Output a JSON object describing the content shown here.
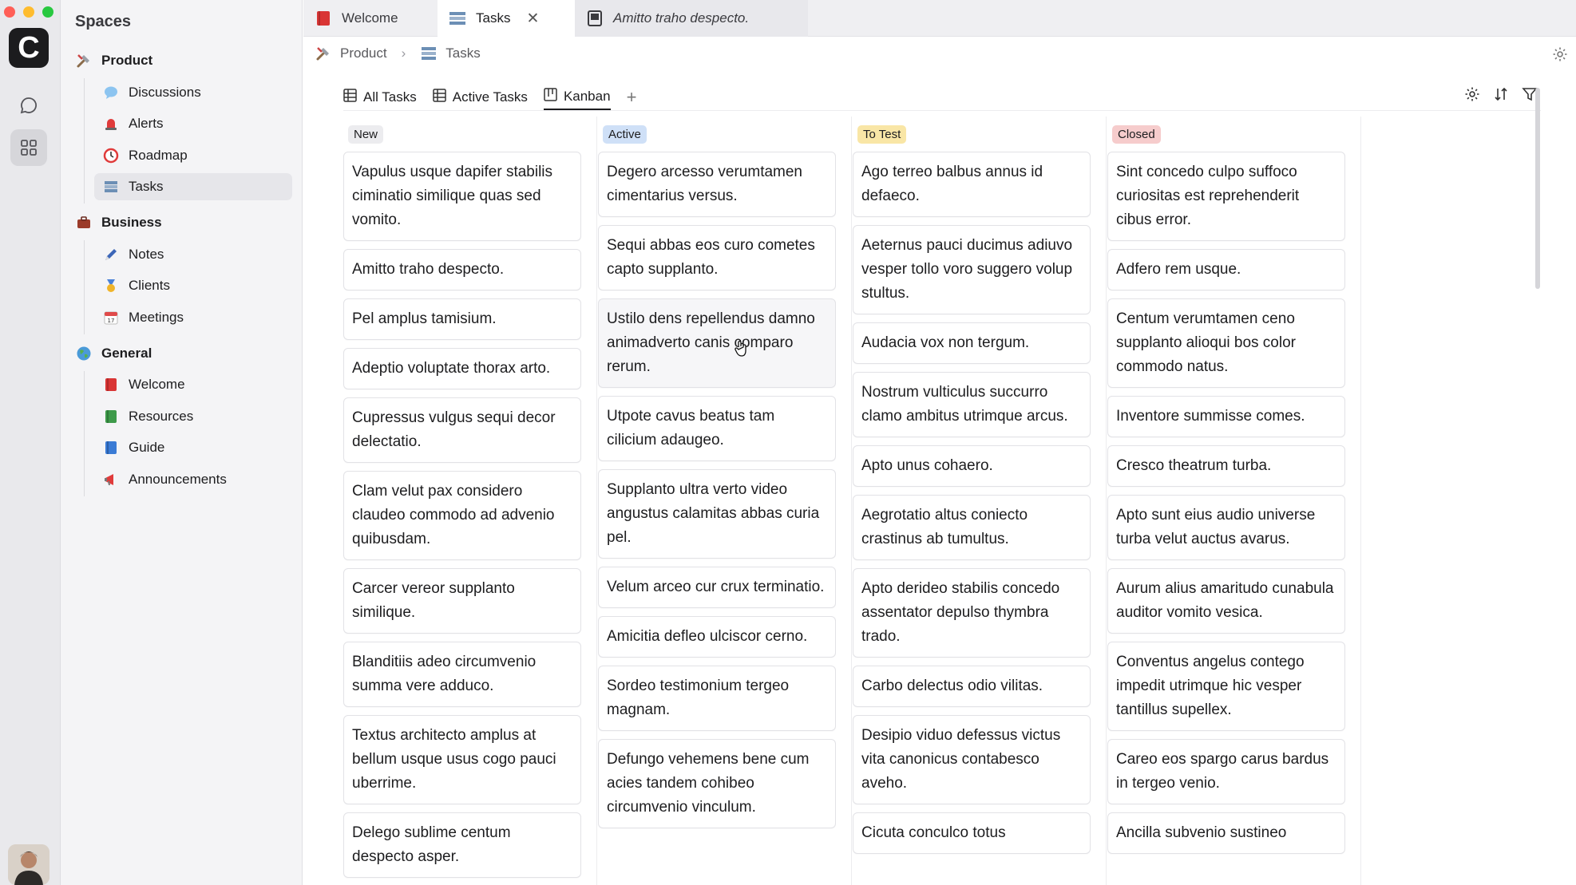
{
  "sidebar": {
    "title": "Spaces",
    "groups": [
      {
        "label": "Product",
        "items": [
          "Discussions",
          "Alerts",
          "Roadmap",
          "Tasks"
        ]
      },
      {
        "label": "Business",
        "items": [
          "Notes",
          "Clients",
          "Meetings"
        ]
      },
      {
        "label": "General",
        "items": [
          "Welcome",
          "Resources",
          "Guide",
          "Announcements"
        ]
      }
    ],
    "selected": "Tasks"
  },
  "tabs": [
    {
      "label": "Welcome"
    },
    {
      "label": "Tasks"
    },
    {
      "label": "Amitto traho despecto."
    }
  ],
  "breadcrumb": {
    "root": "Product",
    "current": "Tasks"
  },
  "views": [
    {
      "label": "All Tasks"
    },
    {
      "label": "Active Tasks"
    },
    {
      "label": "Kanban"
    }
  ],
  "add_view_label": "+",
  "colors": {
    "new": "#ececef",
    "active": "#cfe0f7",
    "totest": "#f9e6a6",
    "closed": "#f6cccc"
  },
  "columns": [
    {
      "label": "New",
      "cards": [
        "Vapulus usque dapifer stabilis ciminatio similique quas sed vomito.",
        "Amitto traho despecto.",
        "Pel amplus tamisium.",
        "Adeptio voluptate thorax arto.",
        "Cupressus vulgus sequi decor delectatio.",
        "Clam velut pax considero claudeo commodo ad advenio quibusdam.",
        "Carcer vereor supplanto similique.",
        "Blanditiis adeo circumvenio summa vere adduco.",
        "Textus architecto amplus at bellum usque usus cogo pauci uberrime.",
        "Delego sublime centum despecto asper."
      ]
    },
    {
      "label": "Active",
      "cards": [
        "Degero arcesso verumtamen cimentarius versus.",
        "Sequi abbas eos curo cometes capto supplanto.",
        "Ustilo dens repellendus damno animadverto canis comparo rerum.",
        "Utpote cavus beatus tam cilicium adaugeo.",
        "Supplanto ultra verto video angustus calamitas abbas curia pel.",
        "Velum arceo cur crux terminatio.",
        "Amicitia defleo ulciscor cerno.",
        "Sordeo testimonium tergeo magnam.",
        "Defungo vehemens bene cum acies tandem cohibeo circumvenio vinculum."
      ]
    },
    {
      "label": "To Test",
      "cards": [
        "Ago terreo balbus annus id defaeco.",
        "Aeternus pauci ducimus adiuvo vesper tollo voro suggero volup stultus.",
        "Audacia vox non tergum.",
        "Nostrum vulticulus succurro clamo ambitus utrimque arcus.",
        "Apto unus cohaero.",
        "Aegrotatio altus coniecto crastinus ab tumultus.",
        "Apto derideo stabilis concedo assentator depulso thymbra trado.",
        "Carbo delectus odio vilitas.",
        "Desipio viduo defessus victus vita canonicus contabesco aveho.",
        "Cicuta conculco totus"
      ]
    },
    {
      "label": "Closed",
      "cards": [
        "Sint concedo culpo suffoco curiositas est reprehenderit cibus error.",
        "Adfero rem usque.",
        "Centum verumtamen ceno supplanto alioqui bos color commodo natus.",
        "Inventore summisse comes.",
        "Cresco theatrum turba.",
        "Apto sunt eius audio universe turba velut auctus avarus.",
        "Aurum alius amaritudo cunabula auditor vomito vesica.",
        "Conventus angelus contego impedit utrimque hic vesper tantillus supellex.",
        "Careo eos spargo carus bardus in tergeo venio.",
        "Ancilla subvenio sustineo"
      ]
    }
  ]
}
